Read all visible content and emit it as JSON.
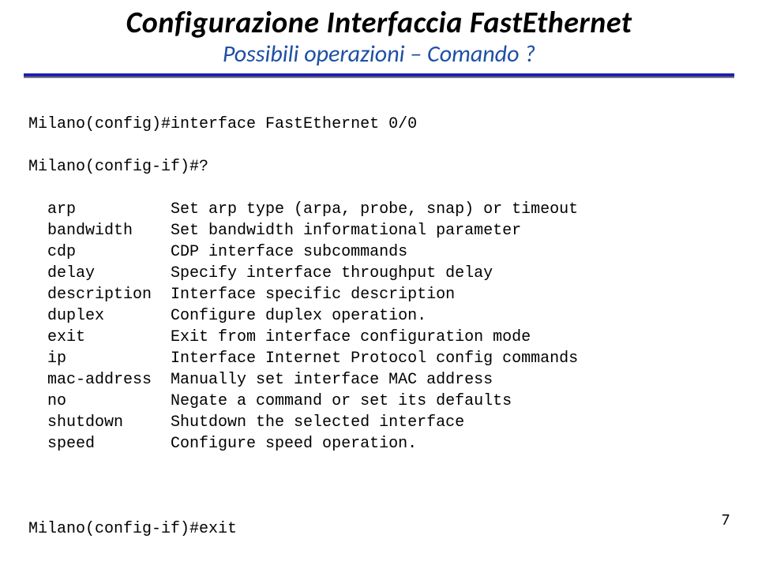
{
  "header": {
    "title": "Configurazione Interfaccia FastEthernet",
    "subtitle": "Possibili operazioni – Comando ?"
  },
  "terminal": {
    "line1": "Milano(config)#interface FastEthernet 0/0",
    "line2": "Milano(config-if)#?",
    "commands": [
      {
        "name": "arp",
        "desc": "Set arp type (arpa, probe, snap) or timeout"
      },
      {
        "name": "bandwidth",
        "desc": "Set bandwidth informational parameter"
      },
      {
        "name": "cdp",
        "desc": "CDP interface subcommands"
      },
      {
        "name": "delay",
        "desc": "Specify interface throughput delay"
      },
      {
        "name": "description",
        "desc": "Interface specific description"
      },
      {
        "name": "duplex",
        "desc": "Configure duplex operation."
      },
      {
        "name": "exit",
        "desc": "Exit from interface configuration mode"
      },
      {
        "name": "ip",
        "desc": "Interface Internet Protocol config commands"
      },
      {
        "name": "mac-address",
        "desc": "Manually set interface MAC address"
      },
      {
        "name": "no",
        "desc": "Negate a command or set its defaults"
      },
      {
        "name": "shutdown",
        "desc": "Shutdown the selected interface"
      },
      {
        "name": "speed",
        "desc": "Configure speed operation."
      }
    ],
    "line_exit": "Milano(config-if)#exit"
  },
  "page_number": "7"
}
